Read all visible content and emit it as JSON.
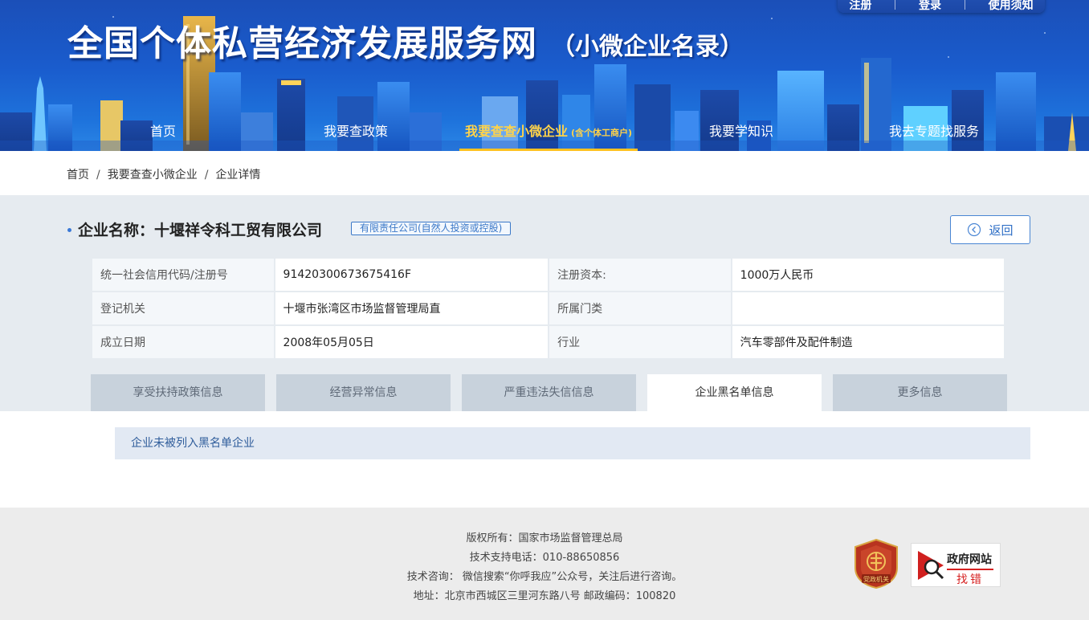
{
  "header": {
    "site_title": "全国个体私营经济发展服务网",
    "site_subtitle": "（小微企业名录）",
    "top_links": [
      "注册",
      "登录",
      "使用须知"
    ],
    "nav": [
      {
        "label": "首页",
        "small": ""
      },
      {
        "label": "我要查政策",
        "small": ""
      },
      {
        "label": "我要查查小微企业",
        "small": "(含个体工商户)"
      },
      {
        "label": "我要学知识",
        "small": ""
      },
      {
        "label": "我去专题找服务",
        "small": ""
      }
    ],
    "active_nav": 2
  },
  "breadcrumb": [
    "首页",
    "我要查查小微企业",
    "企业详情"
  ],
  "company": {
    "name": "企业名称：十堰祥令科工贸有限公司",
    "type_tag": "有限责任公司(自然人投资或控股)",
    "back_label": "返回",
    "rows": [
      {
        "label1": "统一社会信用代码/注册号",
        "value1": "91420300673675416F",
        "label2": "注册资本:",
        "value2": "1000万人民币"
      },
      {
        "label1": "登记机关",
        "value1": "十堰市张湾区市场监督管理局直",
        "label2": "所属门类",
        "value2": ""
      },
      {
        "label1": "成立日期",
        "value1": "2008年05月05日",
        "label2": "行业",
        "value2": "汽车零部件及配件制造"
      }
    ]
  },
  "tabs": [
    "享受扶持政策信息",
    "经营异常信息",
    "严重违法失信信息",
    "企业黑名单信息",
    "更多信息"
  ],
  "active_tab": 3,
  "result_text": "企业未被列入黑名单企业",
  "footer": {
    "lines": [
      "版权所有：国家市场监督管理总局",
      "技术支持电话：010-88650856",
      "技术咨询： 微信搜索“你呼我应”公众号，关注后进行咨询。",
      "地址：北京市西城区三里河东路八号 邮政编码：100820"
    ],
    "badge_party": "党政机关",
    "badge_gov_top": "政府网站",
    "badge_gov_bottom": "找错"
  },
  "colors": {
    "header_blue": "#1a5ccd",
    "active_nav": "#ffd34a",
    "accent_blue": "#3b78c8",
    "panel_bg": "#e6ebf0",
    "tab_inactive": "#c8d2dc"
  }
}
